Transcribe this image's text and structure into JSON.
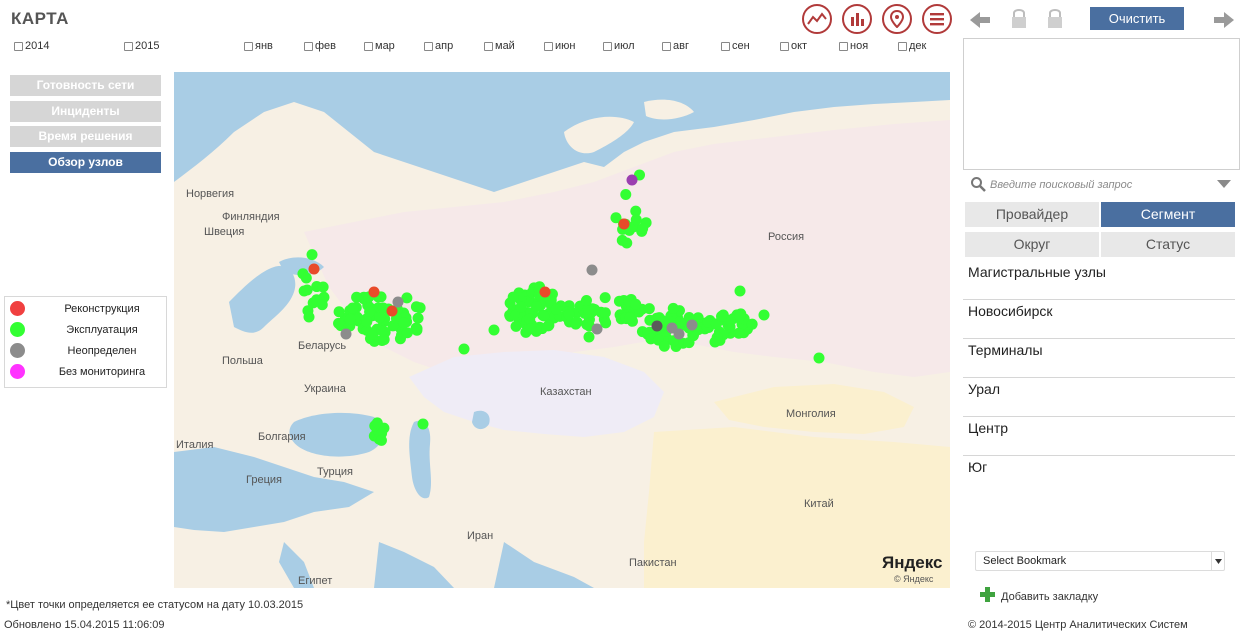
{
  "header": {
    "title": "КАРТА"
  },
  "years": [
    {
      "label": "2014"
    },
    {
      "label": "2015"
    }
  ],
  "months": [
    {
      "label": "янв"
    },
    {
      "label": "фев"
    },
    {
      "label": "мар"
    },
    {
      "label": "апр"
    },
    {
      "label": "май"
    },
    {
      "label": "июн"
    },
    {
      "label": "июл"
    },
    {
      "label": "авг"
    },
    {
      "label": "сен"
    },
    {
      "label": "окт"
    },
    {
      "label": "ноя"
    },
    {
      "label": "дек"
    }
  ],
  "nav": [
    {
      "label": "Готовность сети",
      "active": false
    },
    {
      "label": "Инциденты",
      "active": false
    },
    {
      "label": "Время решения",
      "active": false
    },
    {
      "label": "Обзор узлов",
      "active": true
    }
  ],
  "legend": [
    {
      "label": "Реконструкция",
      "color": "#f04040"
    },
    {
      "label": "Эксплуатация",
      "color": "#33ff33"
    },
    {
      "label": "Неопределен",
      "color": "#8c8c8c"
    },
    {
      "label": "Без мониторинга",
      "color": "#ff33ff"
    }
  ],
  "map": {
    "labels": [
      {
        "text": "Норвегия"
      },
      {
        "text": "Финляндия"
      },
      {
        "text": "Швеция"
      },
      {
        "text": "Россия"
      },
      {
        "text": "Беларусь"
      },
      {
        "text": "Польша"
      },
      {
        "text": "Украина"
      },
      {
        "text": "Казахстан"
      },
      {
        "text": "Монголия"
      },
      {
        "text": "Италия"
      },
      {
        "text": "Болгария"
      },
      {
        "text": "Турция"
      },
      {
        "text": "Греция"
      },
      {
        "text": "Иран"
      },
      {
        "text": "Пакистан"
      },
      {
        "text": "Китай"
      },
      {
        "text": "Египет"
      }
    ],
    "provider": "Яндекс",
    "provider_sub": "© Яндекс",
    "status_colors": {
      "green": "#33ff33",
      "red": "#e84a2a",
      "grey": "#8c8c8c",
      "dark": "#5a5a5a",
      "purple": "#9b3fb0"
    }
  },
  "toolbar": {
    "icons": [
      "line-chart-icon",
      "bar-chart-icon",
      "map-pin-icon",
      "menu-icon"
    ],
    "clear_label": "Очистить"
  },
  "search": {
    "placeholder": "Введите поисковый запрос"
  },
  "tabs": [
    {
      "label": "Провайдер",
      "active": false
    },
    {
      "label": "Сегмент",
      "active": true
    },
    {
      "label": "Округ",
      "active": false
    },
    {
      "label": "Статус",
      "active": false
    }
  ],
  "segments": [
    {
      "label": "Магистральные узлы"
    },
    {
      "label": "Новосибирск"
    },
    {
      "label": "Терминалы"
    },
    {
      "label": "Урал"
    },
    {
      "label": "Центр"
    },
    {
      "label": "Юг"
    }
  ],
  "bookmark": {
    "select_label": "Select Bookmark",
    "add_label": "Добавить закладку"
  },
  "footer": {
    "note": "*Цвет точки определяется ее статусом на дату 10.03.2015",
    "updated": "Обновлено 15.04.2015 11:06:09",
    "copyright": "© 2014-2015 Центр Аналитических Систем"
  }
}
